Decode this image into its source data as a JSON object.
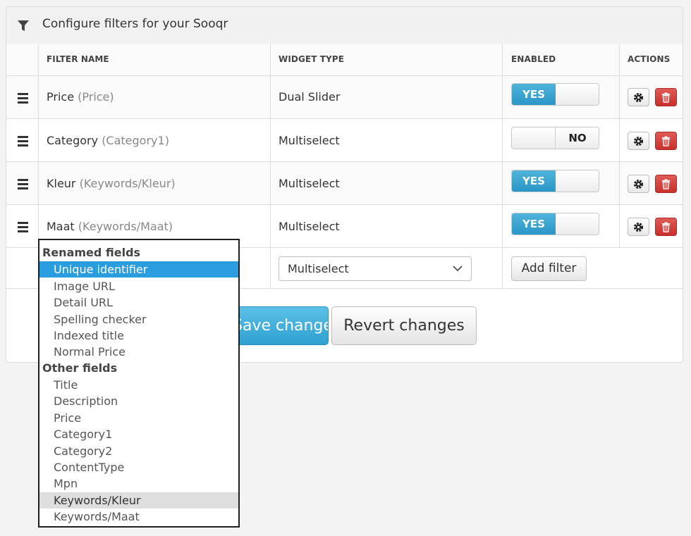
{
  "panel": {
    "title": "Configure filters for your Sooqr"
  },
  "table": {
    "columns": {
      "filter_name": "FILTER NAME",
      "widget_type": "WIDGET TYPE",
      "enabled": "ENABLED",
      "actions": "ACTIONS"
    },
    "rows": [
      {
        "name": "Price",
        "source": "(Price)",
        "widget": "Dual Slider",
        "enabled": true,
        "toggle_label": "YES"
      },
      {
        "name": "Category",
        "source": "(Category1)",
        "widget": "Multiselect",
        "enabled": false,
        "toggle_label": "NO"
      },
      {
        "name": "Kleur",
        "source": "(Keywords/Kleur)",
        "widget": "Multiselect",
        "enabled": true,
        "toggle_label": "YES"
      },
      {
        "name": "Maat",
        "source": "(Keywords/Maat)",
        "widget": "Multiselect",
        "enabled": true,
        "toggle_label": "YES"
      }
    ]
  },
  "new_filter": {
    "widget_select_value": "Multiselect",
    "add_button": "Add filter"
  },
  "footer": {
    "save_label": "Save changes",
    "revert_label": "Revert changes"
  },
  "dropdown": {
    "groups": [
      {
        "label": "Renamed fields",
        "options": [
          "Unique identifier",
          "Image URL",
          "Detail URL",
          "Spelling checker",
          "Indexed title",
          "Normal Price"
        ]
      },
      {
        "label": "Other fields",
        "options": [
          "Title",
          "Description",
          "Price",
          "Category1",
          "Category2",
          "ContentType",
          "Mpn",
          "Keywords/Kleur",
          "Keywords/Maat"
        ]
      }
    ],
    "selected": "Unique identifier",
    "hovered": "Keywords/Kleur"
  },
  "colors": {
    "toggle_on": "#2b96c7",
    "delete_button": "#c9302c",
    "primary_button": "#2ea0d0",
    "dropdown_selected": "#2a9ddf"
  }
}
